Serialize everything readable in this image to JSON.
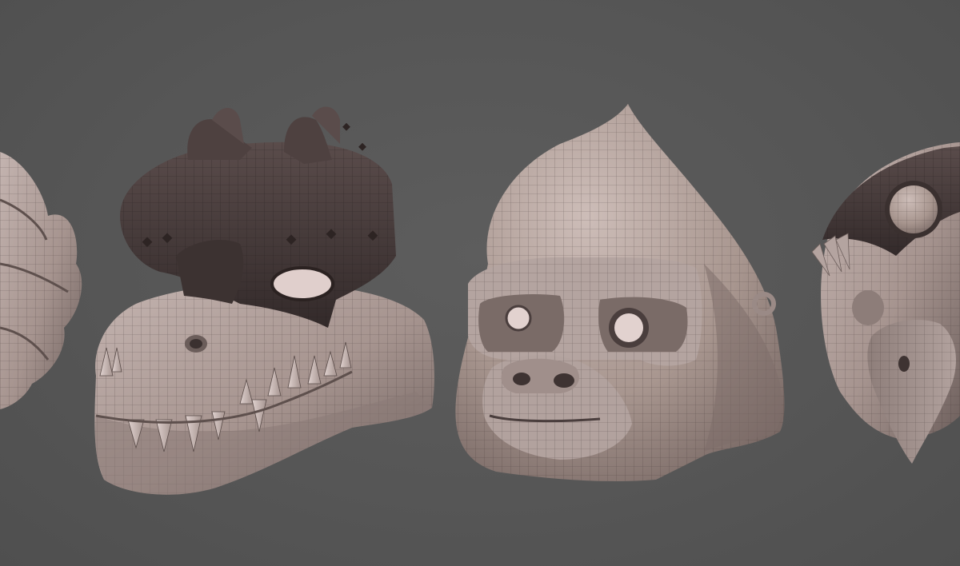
{
  "scene": {
    "background_color": "#555555",
    "material_light": "#b8a8a4",
    "material_mid": "#9a8a86",
    "material_dark": "#4a3e3d",
    "wire_color": "#3a2f2f",
    "models": [
      {
        "id": "partial-creature-left",
        "kind": "spiky creature head (cropped)"
      },
      {
        "id": "crocodile-mask",
        "kind": "crocodile helmet with dark visor and teeth"
      },
      {
        "id": "gorilla-mask",
        "kind": "gorilla head mask with pointed top"
      },
      {
        "id": "eagle-mask",
        "kind": "eagle/bird helmet (cropped)"
      }
    ]
  }
}
